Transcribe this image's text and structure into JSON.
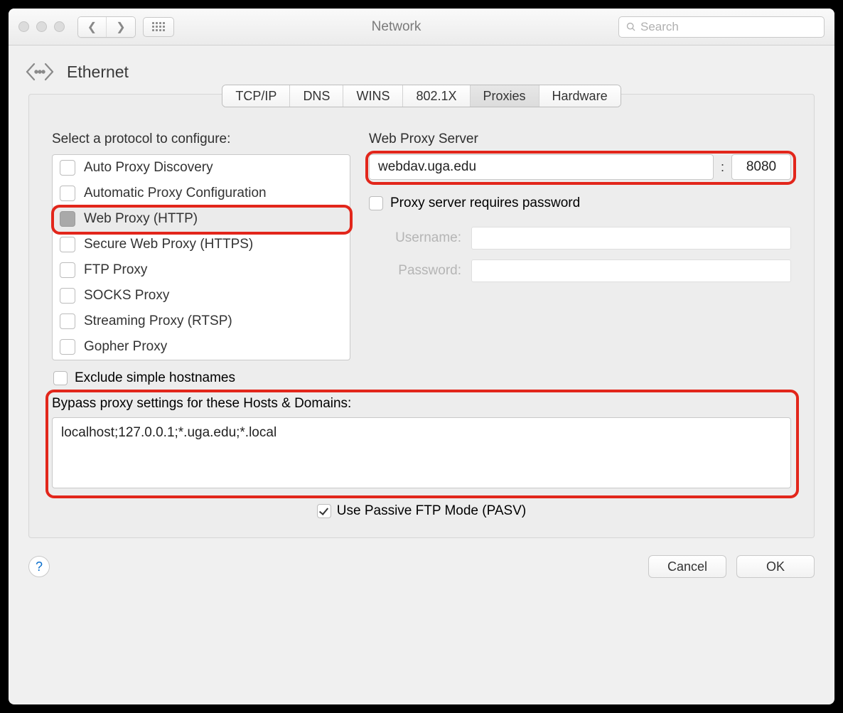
{
  "window": {
    "title": "Network",
    "search_placeholder": "Search"
  },
  "subheader": {
    "title": "Ethernet"
  },
  "tabs": {
    "items": [
      "TCP/IP",
      "DNS",
      "WINS",
      "802.1X",
      "Proxies",
      "Hardware"
    ],
    "active_index": 4
  },
  "left": {
    "title": "Select a protocol to configure:",
    "protocols": [
      {
        "label": "Auto Proxy Discovery",
        "checked": false,
        "selected": false
      },
      {
        "label": "Automatic Proxy Configuration",
        "checked": false,
        "selected": false
      },
      {
        "label": "Web Proxy (HTTP)",
        "checked": "mid",
        "selected": true
      },
      {
        "label": "Secure Web Proxy (HTTPS)",
        "checked": false,
        "selected": false
      },
      {
        "label": "FTP Proxy",
        "checked": false,
        "selected": false
      },
      {
        "label": "SOCKS Proxy",
        "checked": false,
        "selected": false
      },
      {
        "label": "Streaming Proxy (RTSP)",
        "checked": false,
        "selected": false
      },
      {
        "label": "Gopher Proxy",
        "checked": false,
        "selected": false
      }
    ],
    "exclude_simple_label": "Exclude simple hostnames",
    "exclude_simple_checked": false
  },
  "right": {
    "title": "Web Proxy Server",
    "host": "webdav.uga.edu",
    "port": "8080",
    "requires_password_label": "Proxy server requires password",
    "requires_password_checked": false,
    "username_label": "Username:",
    "password_label": "Password:",
    "username": "",
    "password": ""
  },
  "bypass": {
    "label": "Bypass proxy settings for these Hosts & Domains:",
    "value": "localhost;127.0.0.1;*.uga.edu;*.local"
  },
  "pasv": {
    "label": "Use Passive FTP Mode (PASV)",
    "checked": true
  },
  "footer": {
    "cancel": "Cancel",
    "ok": "OK"
  },
  "highlights": [
    "protocol-http",
    "server-row",
    "bypass-box"
  ]
}
